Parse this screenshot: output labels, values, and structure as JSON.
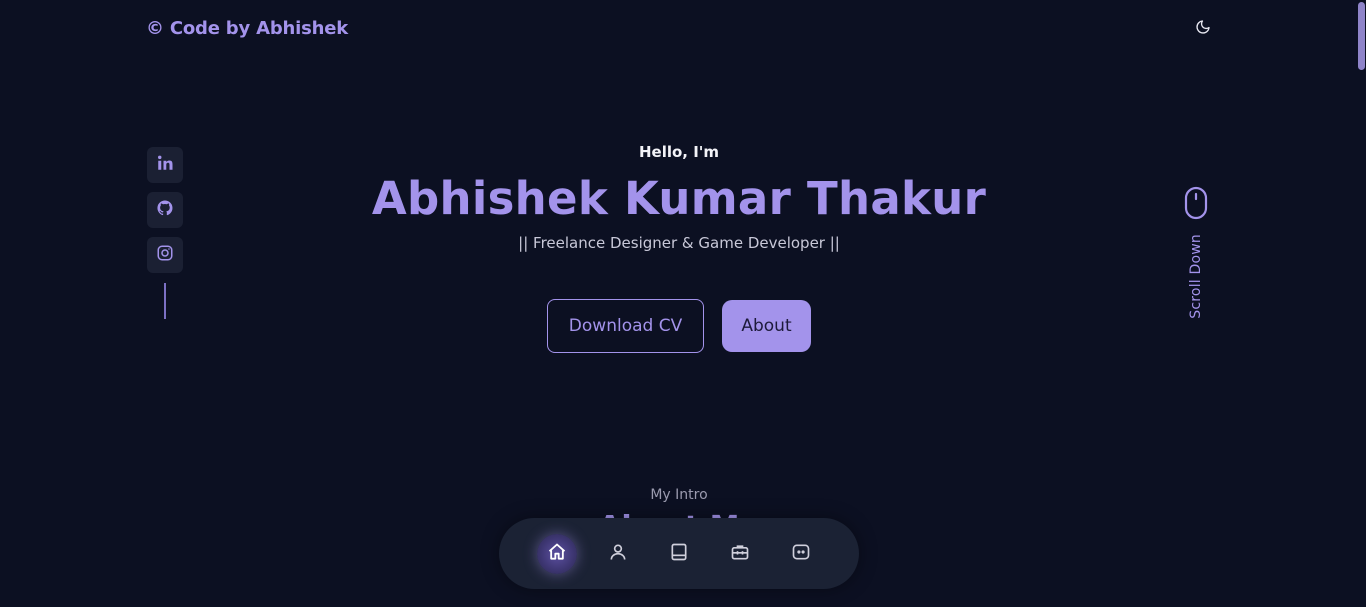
{
  "header": {
    "logo_text": "© Code by Abhishek",
    "theme_toggle_icon": "moon-icon"
  },
  "socials": [
    {
      "name": "linkedin",
      "icon": "linkedin-icon"
    },
    {
      "name": "github",
      "icon": "github-icon"
    },
    {
      "name": "instagram",
      "icon": "instagram-icon"
    }
  ],
  "hero": {
    "greeting": "Hello, I'm",
    "name": "Abhishek Kumar Thakur",
    "tagline": "|| Freelance Designer & Game Developer ||",
    "download_button": "Download CV",
    "about_button": "About",
    "scroll_label": "Scroll Down",
    "scroll_icon": "mouse-icon"
  },
  "intro": {
    "subtitle": "My Intro",
    "title": "About Me"
  },
  "nav": {
    "items": [
      {
        "icon": "home-icon",
        "active": true
      },
      {
        "icon": "user-icon",
        "active": false
      },
      {
        "icon": "book-icon",
        "active": false
      },
      {
        "icon": "briefcase-icon",
        "active": false
      },
      {
        "icon": "chat-icon",
        "active": false
      }
    ]
  },
  "colors": {
    "background": "#0c1022",
    "accent": "#a393eb",
    "surface": "#1b2234"
  }
}
